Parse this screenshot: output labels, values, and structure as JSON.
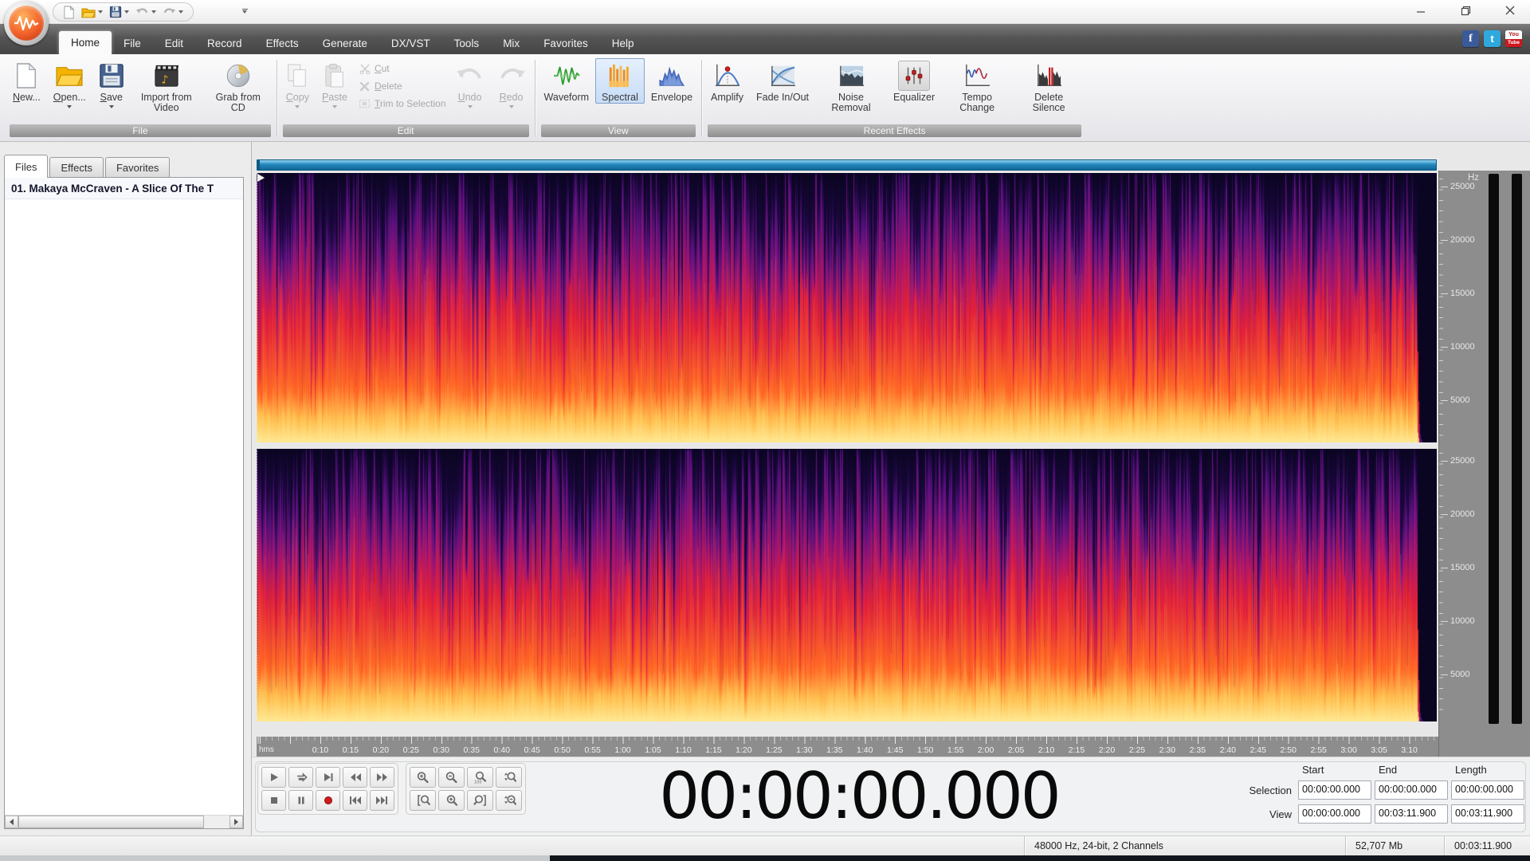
{
  "quick_access": {
    "buttons": [
      "new-file",
      "open-folder",
      "save",
      "undo",
      "redo"
    ],
    "customize": "customize-quick-access"
  },
  "window_controls": [
    "minimize",
    "maximize",
    "close"
  ],
  "menu": {
    "active": "Home",
    "tabs": [
      "Home",
      "File",
      "Edit",
      "Record",
      "Effects",
      "Generate",
      "DX/VST",
      "Tools",
      "Mix",
      "Favorites",
      "Help"
    ]
  },
  "social": [
    "facebook",
    "twitter",
    "youtube"
  ],
  "social_youtube": {
    "top": "You",
    "bottom": "Tube"
  },
  "ribbon": {
    "groups": [
      {
        "label": "File",
        "items": [
          {
            "label": "New...",
            "icon": "new-file"
          },
          {
            "label": "Open...",
            "icon": "open-folder",
            "dropdown": true
          },
          {
            "label": "Save",
            "icon": "save-floppy",
            "dropdown": true
          },
          {
            "label": "Import from Video",
            "icon": "import-video"
          },
          {
            "label": "Grab from CD",
            "icon": "grab-cd"
          }
        ]
      },
      {
        "label": "Edit",
        "items": [
          {
            "label": "Copy",
            "icon": "copy",
            "dropdown": true,
            "disabled": true
          },
          {
            "label": "Paste",
            "icon": "paste",
            "dropdown": true,
            "disabled": true
          },
          {
            "label": "Cut",
            "icon": "cut-scissors",
            "disabled": true
          },
          {
            "label": "Delete",
            "icon": "delete-x",
            "disabled": true
          },
          {
            "label": "Trim to Selection",
            "icon": "trim-selection",
            "disabled": true
          },
          {
            "label": "Undo",
            "icon": "undo-arrow",
            "dropdown": true,
            "disabled": true
          },
          {
            "label": "Redo",
            "icon": "redo-arrow",
            "dropdown": true,
            "disabled": true
          }
        ]
      },
      {
        "label": "View",
        "items": [
          {
            "label": "Waveform",
            "icon": "waveform"
          },
          {
            "label": "Spectral",
            "icon": "spectral",
            "selected": true
          },
          {
            "label": "Envelope",
            "icon": "envelope"
          }
        ]
      },
      {
        "label": "Recent Effects",
        "items": [
          {
            "label": "Amplify",
            "icon": "amplify"
          },
          {
            "label": "Fade In/Out",
            "icon": "fade-in-out"
          },
          {
            "label": "Noise Removal",
            "icon": "noise-removal"
          },
          {
            "label": "Equalizer",
            "icon": "equalizer"
          },
          {
            "label": "Tempo Change",
            "icon": "tempo-change"
          },
          {
            "label": "Delete Silence",
            "icon": "delete-silence"
          }
        ]
      }
    ]
  },
  "sidebar": {
    "tabs": [
      {
        "label": "Files",
        "active": true
      },
      {
        "label": "Effects",
        "active": false
      },
      {
        "label": "Favorites",
        "active": false
      }
    ],
    "files": [
      {
        "label": "01. Makaya McCraven - A Slice Of The T"
      }
    ]
  },
  "editor": {
    "freq_axis": {
      "unit": "Hz",
      "ticks": [
        "25000",
        "20000",
        "15000",
        "10000",
        "5000"
      ]
    },
    "ruler": {
      "lead": "hms",
      "labels": [
        "0:10",
        "0:15",
        "0:20",
        "0:25",
        "0:30",
        "0:35",
        "0:40",
        "0:45",
        "0:50",
        "0:55",
        "1:00",
        "1:05",
        "1:10",
        "1:15",
        "1:20",
        "1:25",
        "1:30",
        "1:35",
        "1:40",
        "1:45",
        "1:50",
        "1:55",
        "2:00",
        "2:05",
        "2:10",
        "2:15",
        "2:20",
        "2:25",
        "2:30",
        "2:35",
        "2:40",
        "2:45",
        "2:50",
        "2:55",
        "3:00",
        "3:05",
        "3:10"
      ]
    },
    "spectrogram": {
      "channels": 2,
      "duration_sec": 191.9,
      "palette": {
        "background": "#0a0521",
        "deep_purple": "#1c0740",
        "purple": "#5a1180",
        "magenta": "#a8156d",
        "red": "#e2203a",
        "orange": "#ff6624",
        "amber": "#ffc050",
        "yellow": "#ffea94"
      }
    }
  },
  "transport": {
    "playback": [
      "play",
      "loop",
      "play-to-end",
      "rewind",
      "fast-forward",
      "stop",
      "pause",
      "record",
      "go-to-start",
      "go-to-end"
    ],
    "zoom": [
      "zoom-in",
      "zoom-out",
      "zoom-100",
      "zoom-vertical-in",
      "zoom-selection-start",
      "zoom-selection",
      "zoom-selection-end",
      "zoom-vertical-out"
    ]
  },
  "time_display": "00:00:00.000",
  "position_panel": {
    "headers": [
      "Start",
      "End",
      "Length"
    ],
    "rows": [
      {
        "label": "Selection",
        "values": [
          "00:00:00.000",
          "00:00:00.000",
          "00:00:00.000"
        ]
      },
      {
        "label": "View",
        "values": [
          "00:00:00.000",
          "00:03:11.900",
          "00:03:11.900"
        ]
      }
    ]
  },
  "statusbar": {
    "format": "48000 Hz, 24-bit, 2 Channels",
    "file_size": "52,707 Mb",
    "duration": "00:03:11.900"
  }
}
